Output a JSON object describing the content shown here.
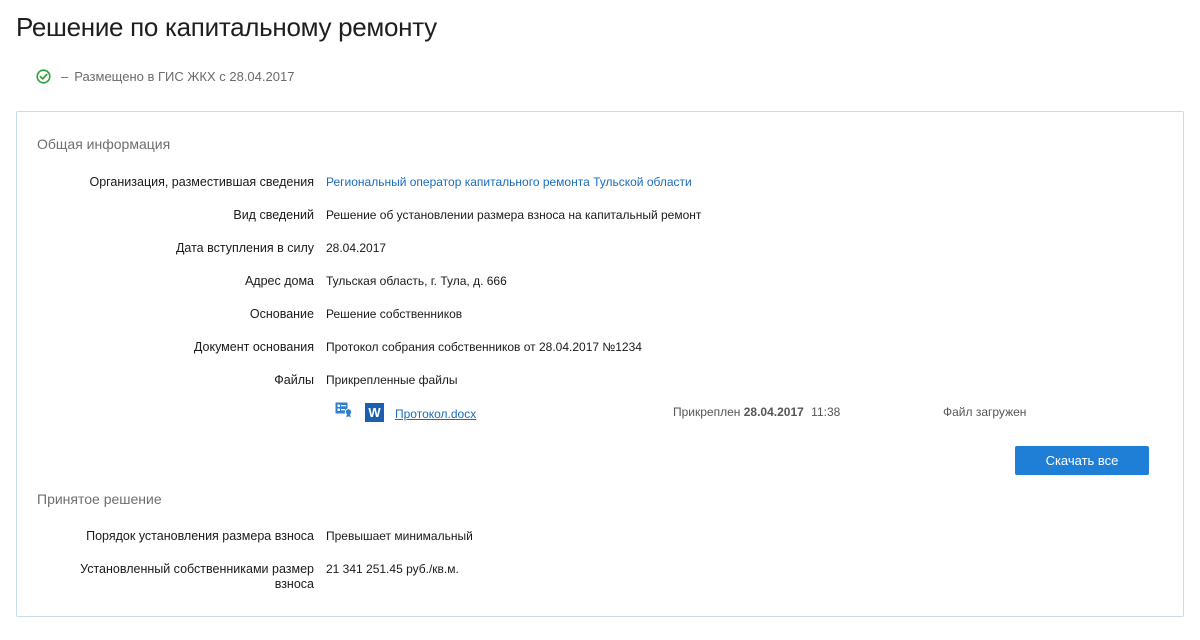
{
  "page": {
    "title": "Решение по капитальному ремонту",
    "status": {
      "dash": "–",
      "text": "Размещено в ГИС ЖКХ с 28.04.2017"
    }
  },
  "general": {
    "section_title": "Общая информация",
    "rows": [
      {
        "label": "Организация, разместившая сведения",
        "value": "Региональный оператор капитального ремонта Тульской области"
      },
      {
        "label": "Вид сведений",
        "value": "Решение об установлении размера взноса на капитальный ремонт"
      },
      {
        "label": "Дата вступления в силу",
        "value": "28.04.2017"
      },
      {
        "label": "Адрес дома",
        "value": "Тульская область, г. Тула, д. 666"
      },
      {
        "label": "Основание",
        "value": "Решение собственников"
      },
      {
        "label": "Документ основания",
        "value": "Протокол собрания собственников от 28.04.2017 №1234"
      },
      {
        "label": "Файлы",
        "value": "Прикрепленные файлы"
      }
    ],
    "file": {
      "word_letter": "W",
      "name": "Протокол.docx",
      "attached_prefix": "Прикреплен",
      "attached_date": "28.04.2017",
      "attached_time": "11:38",
      "status": "Файл загружен"
    },
    "download_all_label": "Скачать все"
  },
  "decision": {
    "section_title": "Принятое решение",
    "rows": [
      {
        "label": "Порядок установления размера взноса",
        "value": "Превышает минимальный"
      },
      {
        "label": "Установленный собственниками размер взноса",
        "value": "21 341 251.45 руб./кв.м."
      }
    ]
  },
  "colors": {
    "accent": "#1f7fd6",
    "link": "#1a6cbf",
    "success": "#2e9e3e",
    "card_border": "#c8dcec"
  }
}
